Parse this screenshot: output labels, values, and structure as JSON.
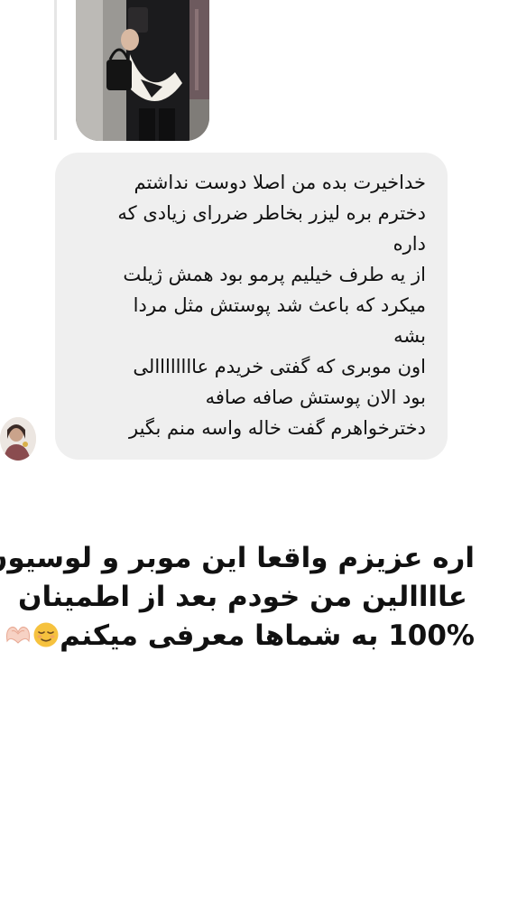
{
  "photo": {
    "alt_subject": "mirror-selfie-photo"
  },
  "message": {
    "lines": [
      "خداخیرت بده من اصلا دوست نداشتم",
      "دخترم بره لیزر بخاطر ضررای زیادی که",
      "داره",
      "از یه طرف خیلیم پرمو بود همش ژیلت",
      "میکرد که باعث شد پوستش مثل مردا",
      "بشه",
      "اون موبری که گفتی خریدم عاااااااالی",
      "بود الان پوستش صافه صافه",
      "دخترخواهرم گفت خاله واسه منم بگیر"
    ],
    "bubble_color": "#efefef"
  },
  "caption": {
    "line1": "اره عزیزم واقعا این موبر و لوسیون",
    "line2": "عاااالین من خودم بعد از اطمینان",
    "line3": "100% به شماها معرفی میکنم",
    "emoji_1": "relieved-face",
    "emoji_2": "heart-hands"
  },
  "colors": {
    "text": "#111111",
    "background": "#ffffff"
  }
}
